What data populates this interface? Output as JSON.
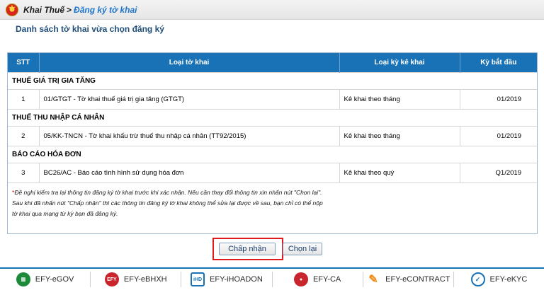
{
  "breadcrumb": {
    "home": "Khai Thuế",
    "separator": ">",
    "current": "Đăng ký tờ khai"
  },
  "page_title": "Danh sách tờ khai vừa chọn đăng ký",
  "table": {
    "headers": {
      "stt": "STT",
      "type": "Loại tờ khai",
      "period_type": "Loại kỳ kê khai",
      "start_period": "Kỳ bắt đầu"
    },
    "groups": [
      {
        "name": "THUẾ GIÁ TRỊ GIA TĂNG",
        "row": {
          "stt": "1",
          "type": "01/GTGT - Tờ khai thuế giá trị gia tăng (GTGT)",
          "period_type": "Kê khai theo tháng",
          "start_period": "01/2019"
        }
      },
      {
        "name": "THUẾ THU NHẬP CÁ NHÂN",
        "row": {
          "stt": "2",
          "type": "05/KK-TNCN - Tờ khai khấu trừ thuế thu nhập cá nhân (TT92/2015)",
          "period_type": "Kê khai theo tháng",
          "start_period": "01/2019"
        }
      },
      {
        "name": "BÁO CÁO HÓA ĐƠN",
        "row": {
          "stt": "3",
          "type": "BC26/AC - Báo cáo tình hình sử dụng hóa đơn",
          "period_type": "Kê khai theo quý",
          "start_period": "Q1/2019"
        }
      }
    ]
  },
  "notes": {
    "star": "*",
    "line1": "Đề nghị kiểm tra lại thông tin đăng ký tờ khai trước khi xác nhận. Nếu cần thay đổi thông tin xin nhấn nút \"Chọn lại\".",
    "line2": "Sau khi đã nhấn nút \"Chấp nhận\" thì các thông tin đăng ký tờ khai không thể sửa lại được về sau, bạn chỉ có thể nộp",
    "line3": "tờ khai qua mạng từ kỳ bạn đã đăng ký."
  },
  "buttons": {
    "accept": "Chấp nhận",
    "reset": "Chọn lại"
  },
  "footer": {
    "brands": [
      "EFY-eGOV",
      "EFY-eBHXH",
      "EFY-iHOADON",
      "EFY-CA",
      "EFY-eCONTRACT",
      "EFY-eKYC"
    ]
  },
  "icons": {
    "emblem": "national-emblem-icon",
    "accent_color": "#1872b5",
    "highlight_color": "#e0191b"
  }
}
